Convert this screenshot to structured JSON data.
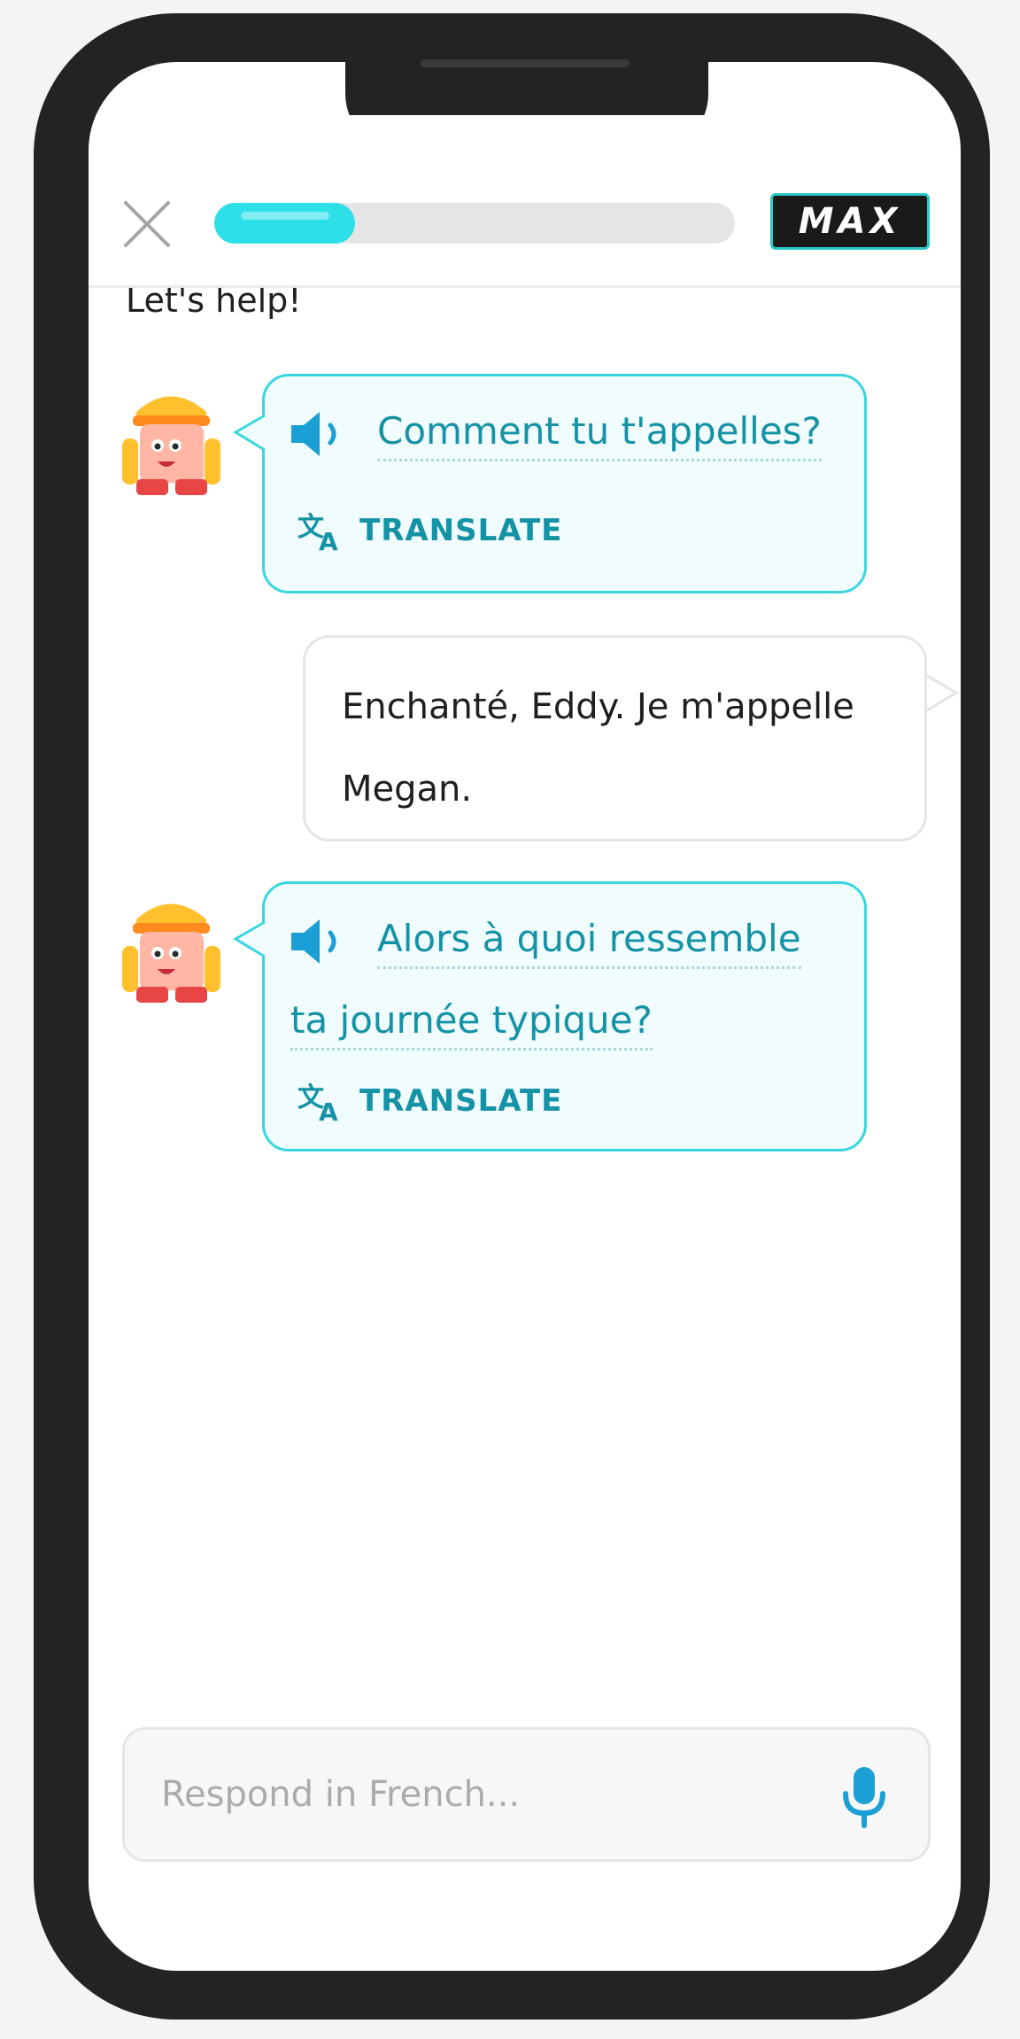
{
  "header": {
    "close_icon": "close-icon",
    "progress": 0.27,
    "badge_label": "MAX"
  },
  "chat": {
    "clipped_text": "Let's help!",
    "messages": [
      {
        "speaker": "character",
        "text": "Comment tu t'appelles?",
        "translate_label": "TRANSLATE"
      },
      {
        "speaker": "user",
        "text": "Enchanté, Eddy. Je m'appelle Megan."
      },
      {
        "speaker": "character",
        "text_line1": "Alors à quoi ressemble",
        "text_line2": "ta journée typique?",
        "translate_label": "TRANSLATE"
      }
    ]
  },
  "input": {
    "placeholder": "Respond in French...",
    "value": ""
  },
  "colors": {
    "accent": "#1492a6",
    "bubble_border": "#3ad6e0",
    "bubble_bg": "#f1fcfe",
    "progress_fill": "#2de0e8",
    "frame": "#232323"
  }
}
